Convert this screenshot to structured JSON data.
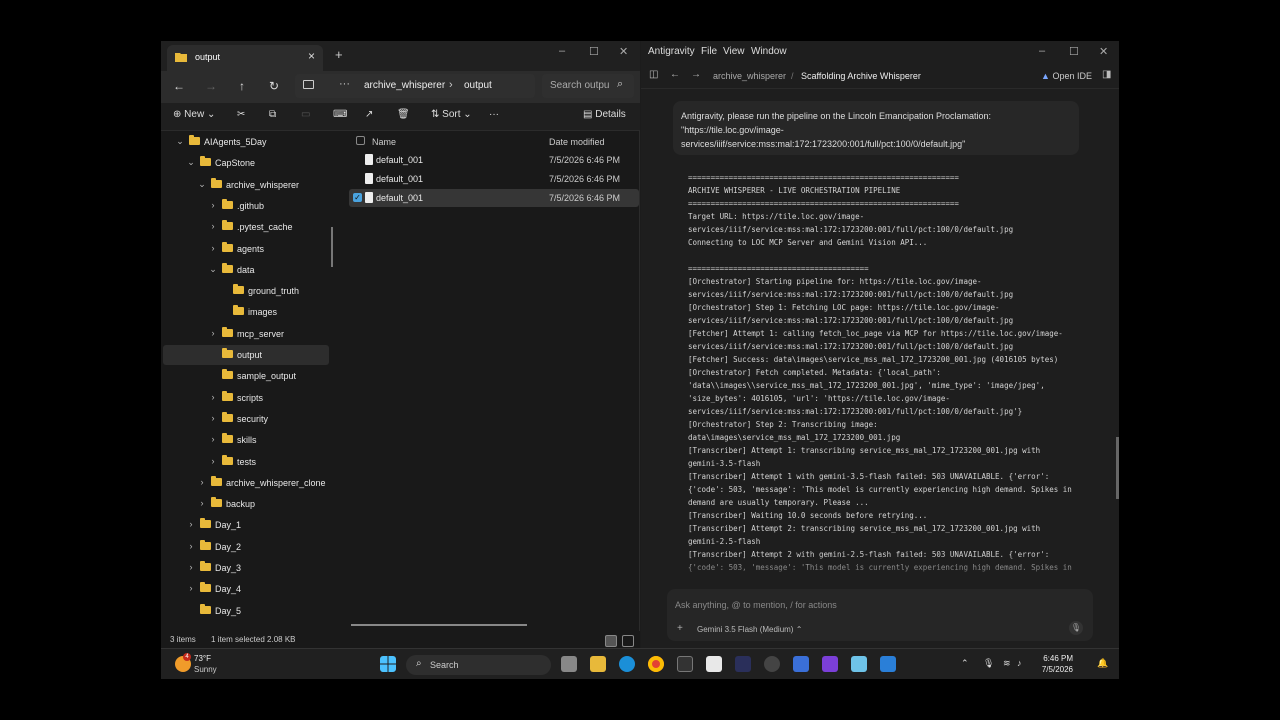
{
  "explorer": {
    "tab_title": "output",
    "address": {
      "crumb1": "archive_whisperer",
      "crumb2": "output",
      "ellipsis": "···"
    },
    "search_placeholder": "Search outpu",
    "toolbar": {
      "new_label": "New",
      "sort_label": "Sort",
      "details_label": "Details",
      "more": "···"
    },
    "tree": [
      {
        "label": "AIAgents_5Day",
        "chev": "⌄"
      },
      {
        "label": "CapStone",
        "chev": "⌄"
      },
      {
        "label": "archive_whisperer",
        "chev": "⌄"
      },
      {
        "label": ".github",
        "chev": "›"
      },
      {
        "label": ".pytest_cache",
        "chev": "›"
      },
      {
        "label": "agents",
        "chev": "›"
      },
      {
        "label": "data",
        "chev": "⌄"
      },
      {
        "label": "ground_truth",
        "chev": ""
      },
      {
        "label": "images",
        "chev": ""
      },
      {
        "label": "mcp_server",
        "chev": "›"
      },
      {
        "label": "output",
        "chev": ""
      },
      {
        "label": "sample_output",
        "chev": ""
      },
      {
        "label": "scripts",
        "chev": "›"
      },
      {
        "label": "security",
        "chev": "›"
      },
      {
        "label": "skills",
        "chev": "›"
      },
      {
        "label": "tests",
        "chev": "›"
      },
      {
        "label": "archive_whisperer_clone",
        "chev": "›"
      },
      {
        "label": "backup",
        "chev": "›"
      },
      {
        "label": "Day_1",
        "chev": "›"
      },
      {
        "label": "Day_2",
        "chev": "›"
      },
      {
        "label": "Day_3",
        "chev": "›"
      },
      {
        "label": "Day_4",
        "chev": "›"
      },
      {
        "label": "Day_5",
        "chev": ""
      }
    ],
    "columns": {
      "name": "Name",
      "date": "Date modified"
    },
    "files": [
      {
        "name": "default_001",
        "date": "7/5/2026 6:46 PM"
      },
      {
        "name": "default_001",
        "date": "7/5/2026 6:46 PM"
      },
      {
        "name": "default_001",
        "date": "7/5/2026 6:46 PM"
      }
    ],
    "status": {
      "items": "3 items",
      "selected": "1 item selected  2.08 KB"
    }
  },
  "antigravity": {
    "menu": [
      "Antigravity",
      "File",
      "View",
      "Window"
    ],
    "breadcrumb": {
      "project": "archive_whisperer",
      "sep": "/",
      "conversation": "Scaffolding Archive Whisperer"
    },
    "open_ide": "Open IDE",
    "prompt_lines": [
      "Antigravity, please run the pipeline on the Lincoln Emancipation Proclamation:",
      "\"https://tile.loc.gov/image-",
      "services/iiif/service:mss:mal:172:1723200:001/full/pct:100/0/default.jpg\""
    ],
    "log_lines": [
      "============================================================",
      "ARCHIVE WHISPERER - LIVE ORCHESTRATION PIPELINE",
      "============================================================",
      "Target URL: https://tile.loc.gov/image-",
      "services/iiif/service:mss:mal:172:1723200:001/full/pct:100/0/default.jpg",
      "Connecting to LOC MCP Server and Gemini Vision API...",
      "",
      "========================================",
      "[Orchestrator] Starting pipeline for: https://tile.loc.gov/image-",
      "services/iiif/service:mss:mal:172:1723200:001/full/pct:100/0/default.jpg",
      "[Orchestrator] Step 1: Fetching LOC page: https://tile.loc.gov/image-",
      "services/iiif/service:mss:mal:172:1723200:001/full/pct:100/0/default.jpg",
      "[Fetcher] Attempt 1: calling fetch_loc_page via MCP for https://tile.loc.gov/image-",
      "services/iiif/service:mss:mal:172:1723200:001/full/pct:100/0/default.jpg",
      "[Fetcher] Success: data\\images\\service_mss_mal_172_1723200_001.jpg (4016105 bytes)",
      "[Orchestrator] Fetch completed. Metadata: {'local_path':",
      "'data\\\\images\\\\service_mss_mal_172_1723200_001.jpg', 'mime_type': 'image/jpeg',",
      "'size_bytes': 4016105, 'url': 'https://tile.loc.gov/image-",
      "services/iiif/service:mss:mal:172:1723200:001/full/pct:100/0/default.jpg'}",
      "[Orchestrator] Step 2: Transcribing image:",
      "data\\images\\service_mss_mal_172_1723200_001.jpg",
      "[Transcriber] Attempt 1: transcribing service_mss_mal_172_1723200_001.jpg with",
      "gemini-3.5-flash",
      "[Transcriber] Attempt 1 with gemini-3.5-flash failed: 503 UNAVAILABLE. {'error':",
      "{'code': 503, 'message': 'This model is currently experiencing high demand. Spikes in",
      "demand are usually temporary. Please ...",
      "[Transcriber] Waiting 10.0 seconds before retrying...",
      "[Transcriber] Attempt 2: transcribing service_mss_mal_172_1723200_001.jpg with",
      "gemini-2.5-flash",
      "[Transcriber] Attempt 2 with gemini-2.5-flash failed: 503 UNAVAILABLE. {'error':",
      "{'code': 503, 'message': 'This model is currently experiencing high demand. Spikes in"
    ],
    "input_placeholder": "Ask anything, @ to mention, / for actions",
    "model_label": "Gemini 3.5 Flash (Medium)"
  },
  "taskbar": {
    "temp": "73°F",
    "condition": "Sunny",
    "badge": "4",
    "search_label": "Search",
    "time": "6:46 PM",
    "date": "7/5/2026"
  }
}
